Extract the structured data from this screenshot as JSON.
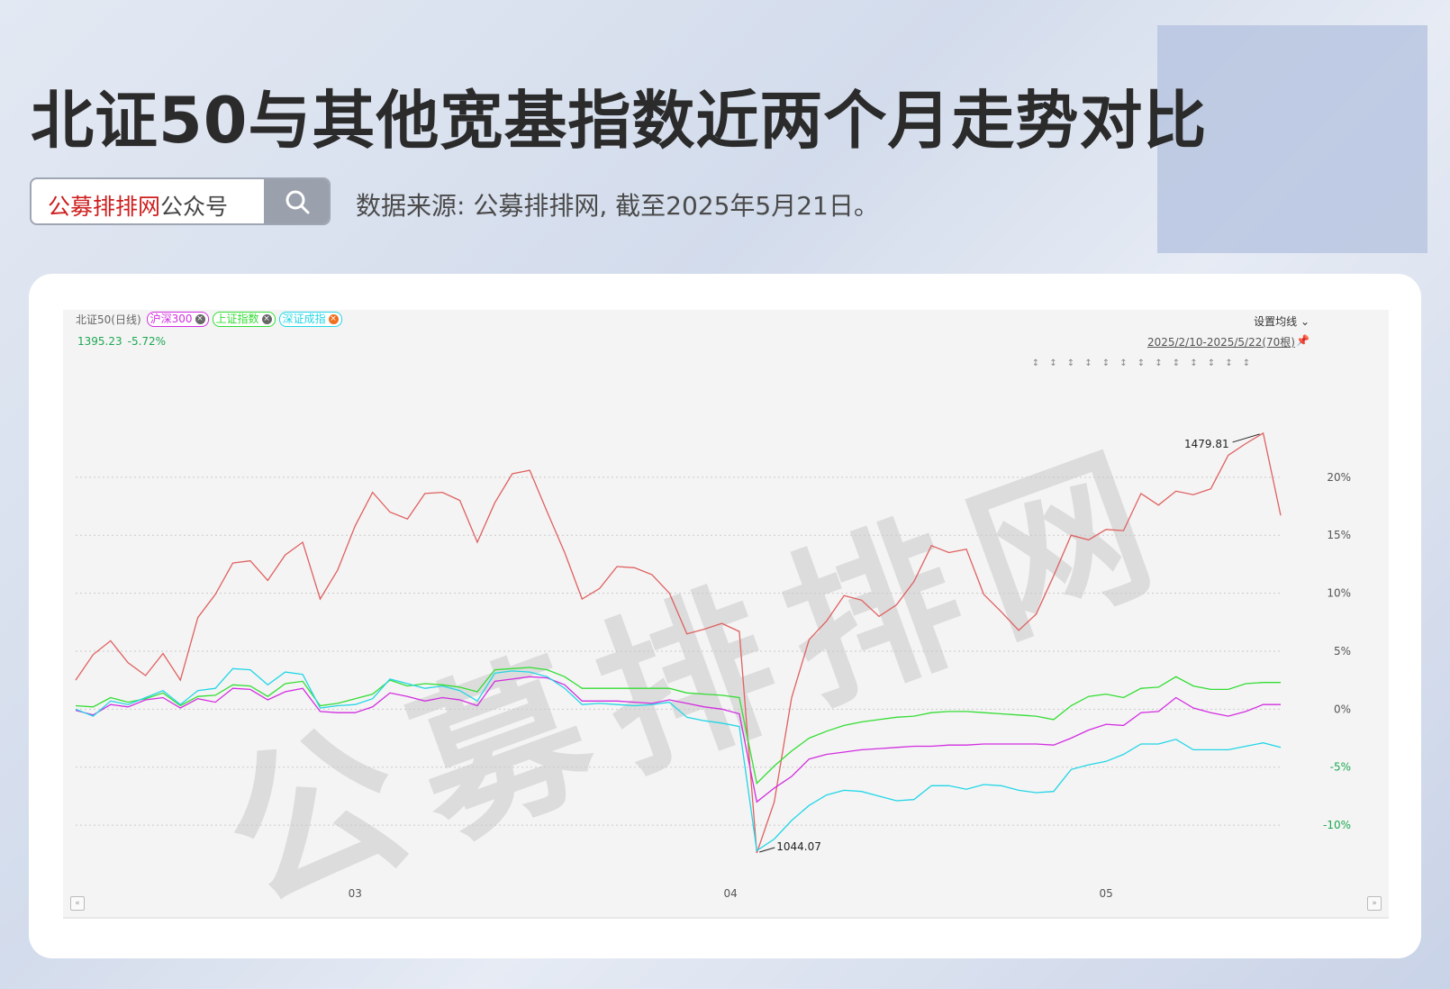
{
  "header": {
    "title": "北证50与其他宽基指数近两个月走势对比",
    "search_brand": "公募排排网",
    "search_suffix": "公众号",
    "source_note": "数据来源: 公募排排网, 截至2025年5月21日。"
  },
  "chart_header": {
    "main_series": "北证50(日线)",
    "tags": [
      "沪深300",
      "上证指数",
      "深证成指"
    ],
    "current_value": "1395.23",
    "current_change": "-5.72%",
    "settings_label": "设置均线",
    "date_range": "2025/2/10-2025/5/22(70根)",
    "watermark": "公募排排网"
  },
  "colors": {
    "bz50": "#e06060",
    "hs300": "#d22ee0",
    "sz": "#33dd33",
    "szcz": "#22d6e6",
    "axis_positive": "#555555",
    "axis_negative": "#1da853"
  },
  "chart_data": {
    "type": "line",
    "x": [
      1,
      2,
      3,
      4,
      5,
      6,
      7,
      8,
      9,
      10,
      11,
      12,
      13,
      14,
      15,
      16,
      17,
      18,
      19,
      20,
      21,
      22,
      23,
      24,
      25,
      26,
      27,
      28,
      29,
      30,
      31,
      32,
      33,
      34,
      35,
      36,
      37,
      38,
      39,
      40,
      41,
      42,
      43,
      44,
      45,
      46,
      47,
      48,
      49,
      50,
      51,
      52,
      53,
      54,
      55,
      56,
      57,
      58,
      59,
      60,
      61,
      62,
      63,
      64,
      65,
      66,
      67,
      68,
      69,
      70
    ],
    "x_ticks": [
      {
        "x": 17,
        "label": "03"
      },
      {
        "x": 38.5,
        "label": "04"
      },
      {
        "x": 60,
        "label": "05"
      }
    ],
    "series": [
      {
        "name": "北证50(日线)",
        "color_key": "bz50",
        "values": [
          2.5,
          4.7,
          5.9,
          4.0,
          2.9,
          4.8,
          2.5,
          7.9,
          9.9,
          12.6,
          12.8,
          11.1,
          13.3,
          14.4,
          9.5,
          12.0,
          15.8,
          18.7,
          17.0,
          16.4,
          18.6,
          18.7,
          18.0,
          14.4,
          17.8,
          20.3,
          20.6,
          17.0,
          13.5,
          9.5,
          10.4,
          12.3,
          12.2,
          11.6,
          10.0,
          6.5,
          6.9,
          7.4,
          6.7,
          -12.4,
          -8.0,
          1.0,
          6.0,
          7.6,
          9.8,
          9.4,
          8.0,
          9.0,
          11.0,
          14.1,
          13.5,
          13.8,
          9.9,
          8.4,
          6.8,
          8.2,
          11.5,
          15.0,
          14.6,
          15.5,
          15.4,
          18.6,
          17.6,
          18.8,
          18.5,
          19.0,
          21.9,
          22.9,
          23.8,
          16.7
        ]
      },
      {
        "name": "沪深300",
        "color_key": "hs300",
        "values": [
          -0.1,
          -0.5,
          0.4,
          0.2,
          0.8,
          1.0,
          0.1,
          0.9,
          0.6,
          1.8,
          1.7,
          0.8,
          1.5,
          1.8,
          -0.2,
          -0.3,
          -0.3,
          0.2,
          1.4,
          1.1,
          0.7,
          1.0,
          0.8,
          0.3,
          2.4,
          2.6,
          2.8,
          2.7,
          2.1,
          0.7,
          0.7,
          0.7,
          0.6,
          0.5,
          0.8,
          0.5,
          0.2,
          0.0,
          -0.4,
          -8.0,
          -6.8,
          -5.8,
          -4.3,
          -3.9,
          -3.7,
          -3.5,
          -3.4,
          -3.3,
          -3.2,
          -3.2,
          -3.1,
          -3.1,
          -3.0,
          -3.0,
          -3.0,
          -3.0,
          -3.1,
          -2.5,
          -1.8,
          -1.3,
          -1.4,
          -0.3,
          -0.2,
          1.0,
          0.1,
          -0.3,
          -0.6,
          -0.2,
          0.4,
          0.4
        ]
      },
      {
        "name": "上证指数",
        "color_key": "sz",
        "values": [
          0.3,
          0.2,
          1.0,
          0.6,
          0.9,
          1.4,
          0.3,
          1.1,
          1.2,
          2.1,
          2.0,
          1.1,
          2.2,
          2.4,
          0.3,
          0.5,
          0.9,
          1.3,
          2.5,
          2.0,
          2.2,
          2.1,
          1.9,
          1.5,
          3.4,
          3.5,
          3.6,
          3.4,
          2.8,
          1.8,
          1.8,
          1.8,
          1.8,
          1.8,
          1.8,
          1.4,
          1.3,
          1.2,
          1.0,
          -6.4,
          -4.9,
          -3.6,
          -2.5,
          -1.9,
          -1.4,
          -1.1,
          -0.9,
          -0.7,
          -0.6,
          -0.3,
          -0.2,
          -0.2,
          -0.3,
          -0.4,
          -0.5,
          -0.6,
          -0.9,
          0.3,
          1.1,
          1.3,
          1.0,
          1.8,
          1.9,
          2.8,
          2.0,
          1.7,
          1.7,
          2.2,
          2.3,
          2.3
        ]
      },
      {
        "name": "深证成指",
        "color_key": "szcz",
        "values": [
          0.0,
          -0.6,
          0.7,
          0.4,
          1.0,
          1.6,
          0.4,
          1.6,
          1.8,
          3.5,
          3.4,
          2.1,
          3.2,
          3.0,
          0.1,
          0.3,
          0.4,
          0.9,
          2.6,
          2.2,
          1.8,
          2.0,
          1.6,
          0.7,
          3.1,
          3.3,
          3.2,
          2.8,
          1.8,
          0.4,
          0.5,
          0.4,
          0.3,
          0.4,
          0.6,
          -0.7,
          -1.0,
          -1.2,
          -1.5,
          -12.2,
          -11.2,
          -9.6,
          -8.3,
          -7.4,
          -7.0,
          -7.1,
          -7.5,
          -7.9,
          -7.8,
          -6.6,
          -6.6,
          -6.9,
          -6.5,
          -6.6,
          -7.0,
          -7.2,
          -7.1,
          -5.2,
          -4.8,
          -4.5,
          -3.9,
          -3.0,
          -3.0,
          -2.6,
          -3.5,
          -3.5,
          -3.5,
          -3.2,
          -2.9,
          -3.3
        ]
      }
    ],
    "y_ticks": [
      -10,
      -5,
      0,
      5,
      10,
      15,
      20
    ],
    "y_tick_labels": [
      "-10%",
      "-5%",
      "0%",
      "5%",
      "10%",
      "15%",
      "20%"
    ],
    "ylim": [
      -14.5,
      29
    ],
    "annotations": [
      {
        "label": "1479.81",
        "x": 69,
        "y": 23.8
      },
      {
        "label": "1044.07",
        "x": 40,
        "y": -12.4
      }
    ],
    "grid": true
  }
}
